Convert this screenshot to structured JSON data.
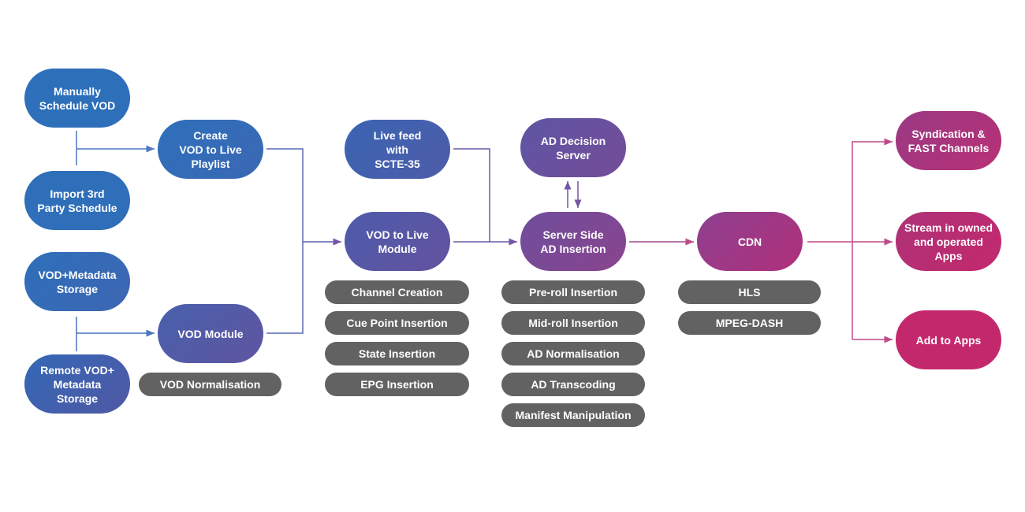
{
  "nodes": {
    "manual": "Manually\nSchedule VOD",
    "import": "Import 3rd\nParty Schedule",
    "storage": "VOD+Metadata\nStorage",
    "remote": "Remote VOD+\nMetadata\nStorage",
    "playlist": "Create\nVOD to Live\nPlaylist",
    "vod_module": "VOD Module",
    "live_feed": "Live feed\nwith\nSCTE-35",
    "vod_live_module": "VOD to Live\nModule",
    "ad_decision": "AD Decision\nServer",
    "ssai": "Server Side\nAD Insertion",
    "cdn": "CDN",
    "syndication": "Syndication &\nFAST Channels",
    "stream": "Stream in owned\nand operated\nApps",
    "add_apps": "Add to Apps"
  },
  "tags": {
    "vod_module": [
      "VOD Normalisation"
    ],
    "vod_live_module": [
      "Channel Creation",
      "Cue Point Insertion",
      "State Insertion",
      "EPG Insertion"
    ],
    "ssai": [
      "Pre-roll Insertion",
      "Mid-roll Insertion",
      "AD Normalisation",
      "AD Transcoding",
      "Manifest Manipulation"
    ],
    "cdn": [
      "HLS",
      "MPEG-DASH"
    ]
  },
  "colors": {
    "blue": "#2e6fba",
    "purple": "#6a52a0",
    "magenta": "#c4286c",
    "tag": "#626262"
  }
}
